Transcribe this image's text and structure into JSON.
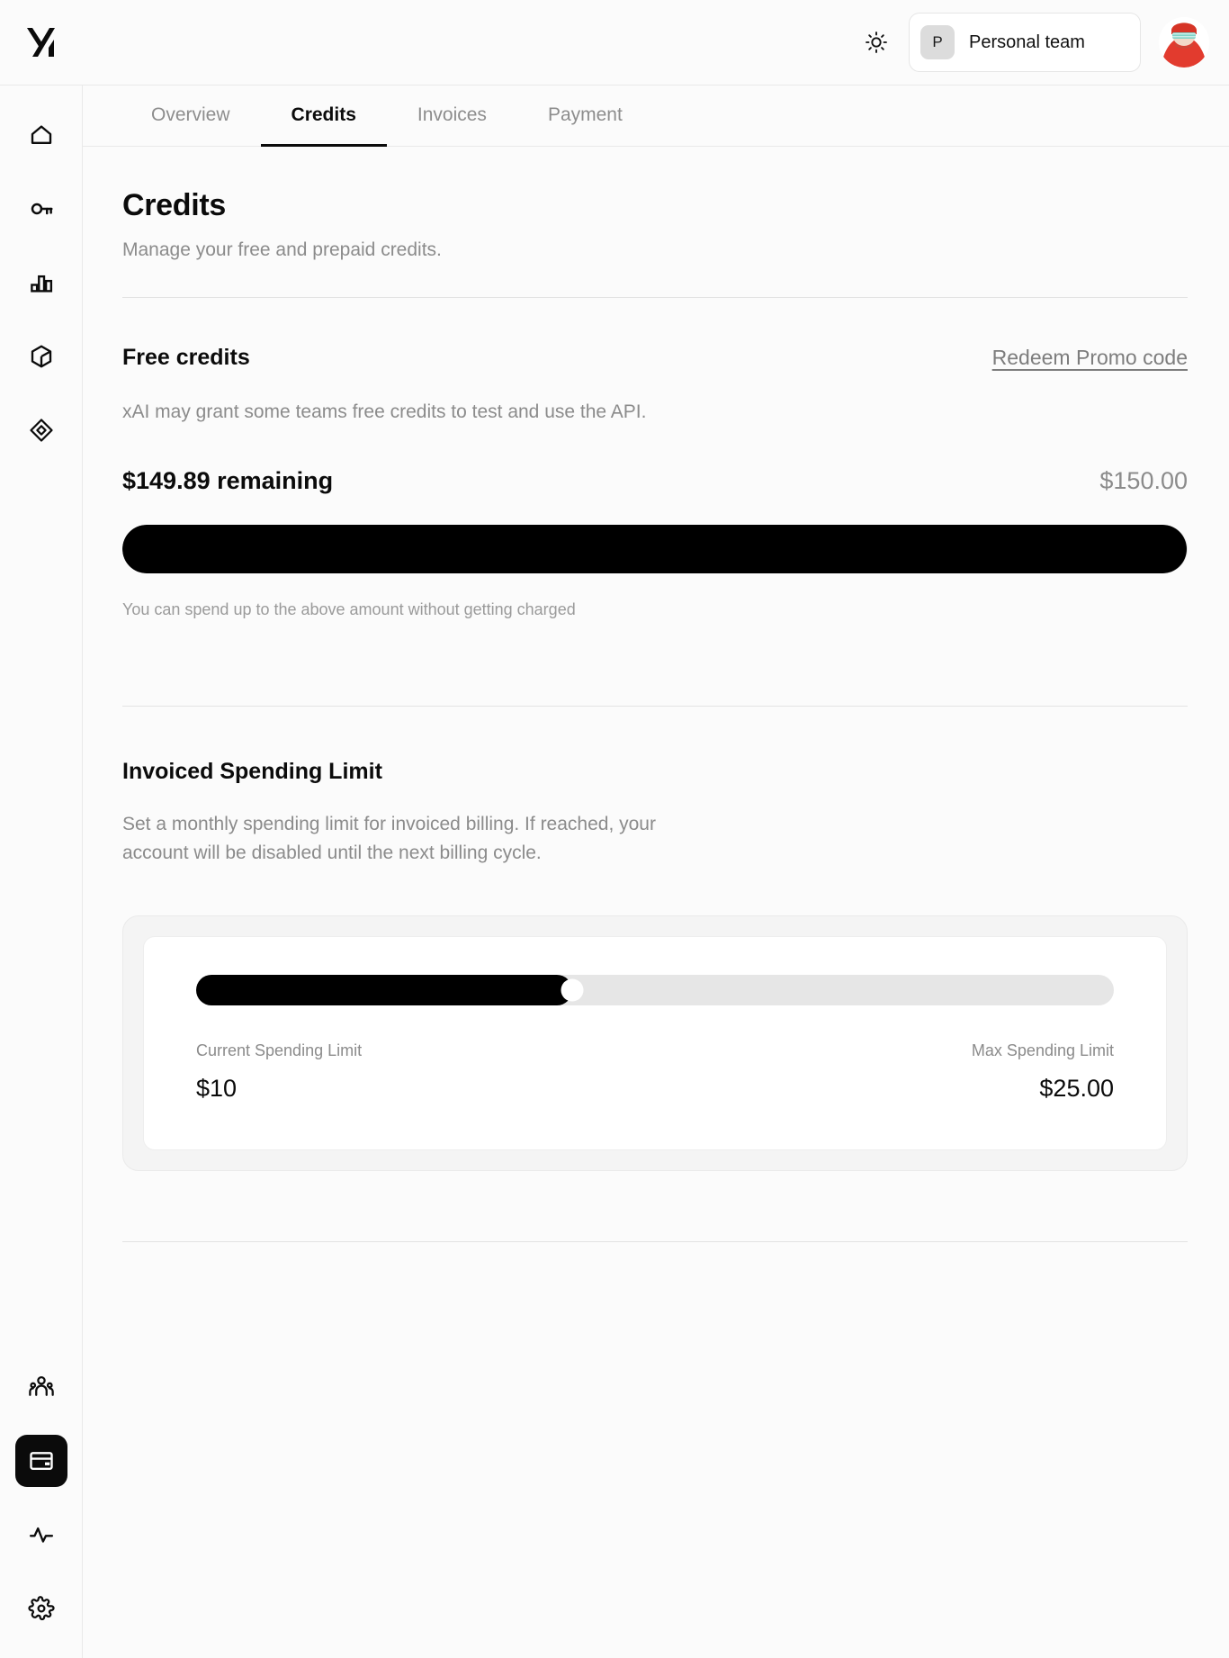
{
  "topbar": {
    "logo_icon": "xai-logo",
    "theme_icon": "sun-icon",
    "team": {
      "avatar_initial": "P",
      "name": "Personal team"
    },
    "user_avatar_icon": "user-avatar"
  },
  "sidebar": {
    "top_items": [
      {
        "icon": "home-icon",
        "name": "sidebar-item-home"
      },
      {
        "icon": "key-icon",
        "name": "sidebar-item-api-keys"
      },
      {
        "icon": "bar-chart-icon",
        "name": "sidebar-item-usage"
      },
      {
        "icon": "cube-icon",
        "name": "sidebar-item-models"
      },
      {
        "icon": "diamond-target-icon",
        "name": "sidebar-item-fine-tuning"
      }
    ],
    "bottom_items": [
      {
        "icon": "users-icon",
        "name": "sidebar-item-team"
      },
      {
        "icon": "credit-card-icon",
        "name": "sidebar-item-billing",
        "active": true
      },
      {
        "icon": "activity-pulse-icon",
        "name": "sidebar-item-status"
      },
      {
        "icon": "gear-icon",
        "name": "sidebar-item-settings"
      }
    ]
  },
  "tabs": [
    {
      "label": "Overview",
      "active": false
    },
    {
      "label": "Credits",
      "active": true
    },
    {
      "label": "Invoices",
      "active": false
    },
    {
      "label": "Payment",
      "active": false
    }
  ],
  "page": {
    "title": "Credits",
    "subtitle": "Manage your free and prepaid credits."
  },
  "free_credits": {
    "title": "Free credits",
    "promo_link": "Redeem Promo code",
    "description": "xAI may grant some teams free credits to test and use the API.",
    "remaining_label": "$149.89 remaining",
    "total_label": "$150.00",
    "progress_percent": 99.9,
    "hint": "You can spend up to the above amount without getting charged"
  },
  "spending_limit": {
    "title": "Invoiced Spending Limit",
    "description": "Set a monthly spending limit for invoiced billing. If reached, your account will be disabled until the next billing cycle.",
    "slider_percent": 41,
    "current_label": "Current Spending Limit",
    "current_value": "$10",
    "max_label": "Max Spending Limit",
    "max_value": "$25.00"
  },
  "colors": {
    "accent": "#000000",
    "page_bg": "#fbfbfb",
    "muted_text": "#8b8b8b",
    "track": "#e6e6e6"
  }
}
